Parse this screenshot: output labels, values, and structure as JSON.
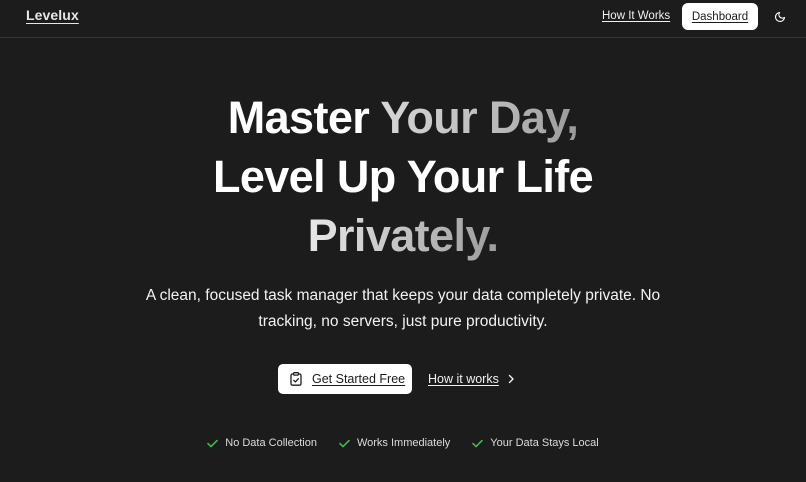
{
  "header": {
    "brand": "Levelux",
    "nav_link": "How It Works",
    "dashboard_label": "Dashboard",
    "theme_icon": "moon-icon"
  },
  "hero": {
    "line1_a": "Master ",
    "line1_b": "Your ",
    "line1_c": "Day,",
    "line2": "Level Up Your Life",
    "line3": "Privately.",
    "subtitle": "A clean, focused task manager that keeps your data completely private. No tracking, no servers, just pure productivity."
  },
  "cta": {
    "primary_label": "Get Started Free",
    "primary_icon": "clipboard-check-icon",
    "secondary_label": "How it works",
    "secondary_icon": "chevron-right-icon"
  },
  "features": [
    {
      "label": "No Data Collection",
      "icon": "check-icon"
    },
    {
      "label": "Works Immediately",
      "icon": "check-icon"
    },
    {
      "label": "Your Data Stays Local",
      "icon": "check-icon"
    }
  ],
  "colors": {
    "background": "#1c1c1c",
    "accent_check": "#3fb950",
    "button_bg": "#ffffff"
  }
}
